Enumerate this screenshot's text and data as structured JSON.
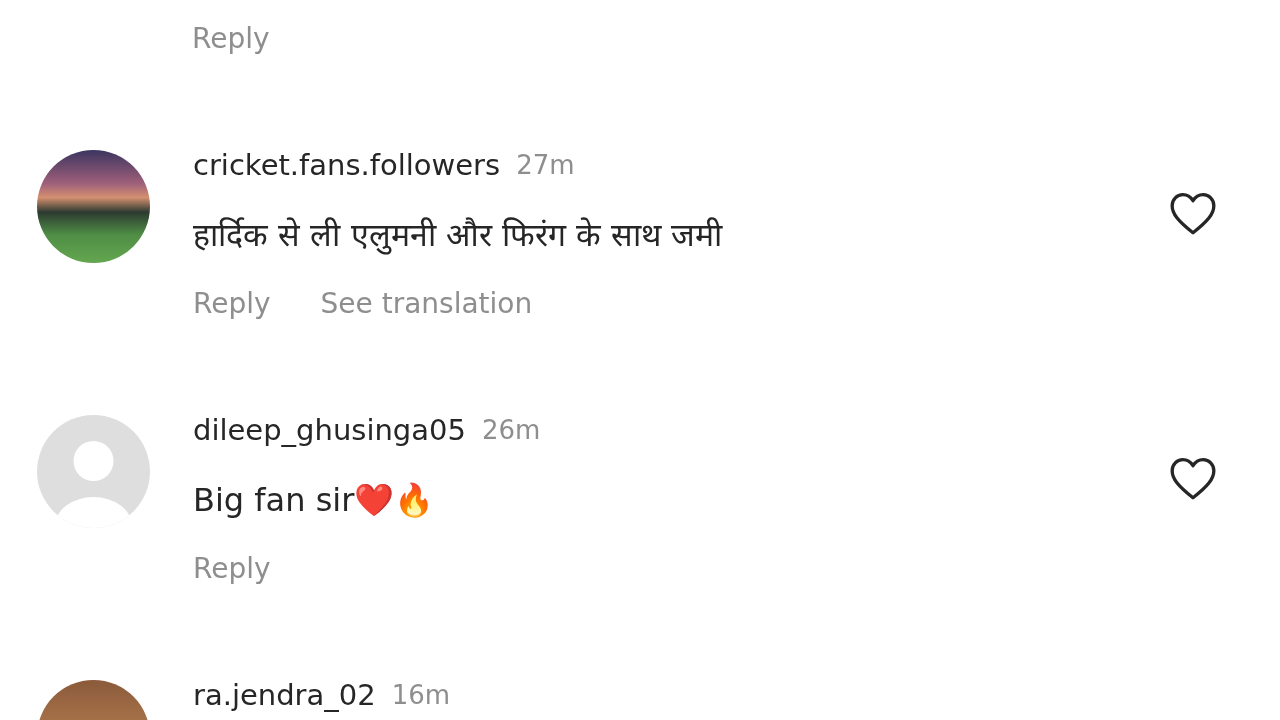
{
  "top_comment": {
    "actions": [
      {
        "label": "Reply"
      }
    ]
  },
  "comments": [
    {
      "username": "cricket.fans.followers",
      "time": "27m",
      "avatar": {
        "kind": "photo"
      },
      "text": "हार्दिक से ली एलुमनी और फिरंग के साथ जमी",
      "liked": false,
      "actions": [
        {
          "label": "Reply"
        },
        {
          "label": "See translation"
        }
      ]
    },
    {
      "username": "dileep_ghusinga05",
      "time": "26m",
      "avatar": {
        "kind": "default"
      },
      "text": "Big fan sir❤️🔥",
      "liked": false,
      "actions": [
        {
          "label": "Reply"
        }
      ]
    },
    {
      "username": "ra.jendra_02",
      "time": "16m",
      "avatar": {
        "kind": "photo-brown"
      }
    }
  ]
}
